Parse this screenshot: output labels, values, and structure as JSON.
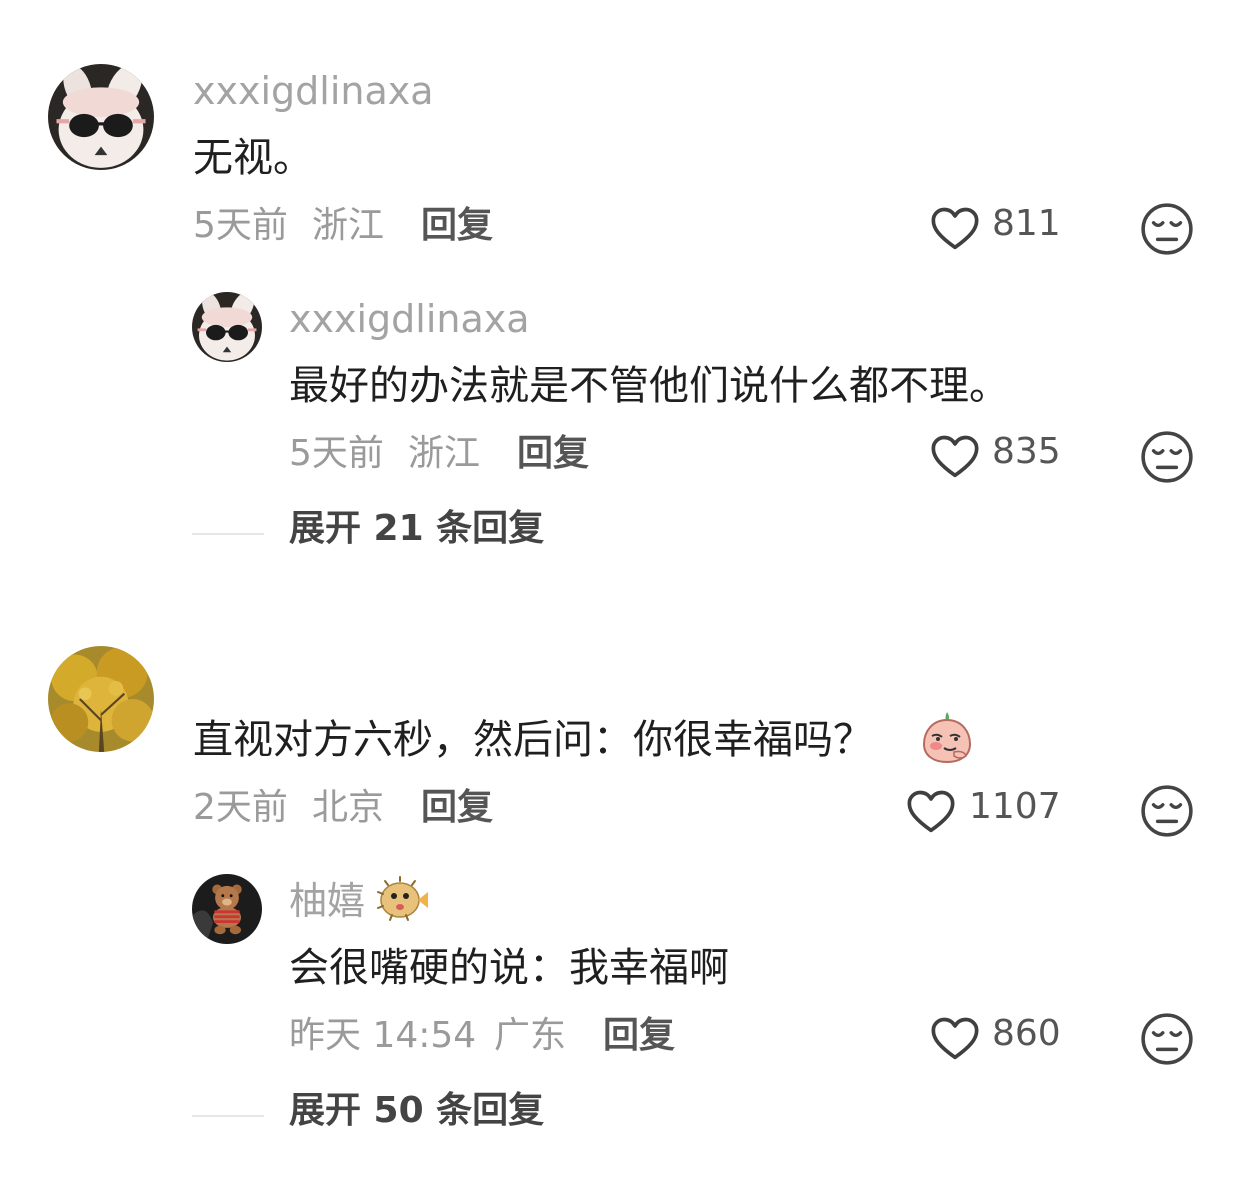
{
  "comments": [
    {
      "username": "xxxigdlinaxa",
      "text": "无视。",
      "time": "5天前",
      "location": "浙江",
      "reply_label": "回复",
      "likes": "811",
      "sub": {
        "username": "xxxigdlinaxa",
        "text": "最好的办法就是不管他们说什么都不理。",
        "time": "5天前",
        "location": "浙江",
        "reply_label": "回复",
        "likes": "835"
      },
      "expand_label": "展开 21 条回复"
    },
    {
      "username": "",
      "text": "直视对方六秒，然后问：你很幸福吗？",
      "emoji": "smirking-peach-sticker",
      "time": "2天前",
      "location": "北京",
      "reply_label": "回复",
      "likes": "1107",
      "sub": {
        "username": "柚嬉",
        "username_emoji": "pufferfish-emoji",
        "text": "会很嘴硬的说：我幸福啊",
        "time": "昨天 14:54",
        "location": "广东",
        "reply_label": "回复",
        "likes": "860"
      },
      "expand_label": "展开 50 条回复"
    }
  ],
  "icons": {
    "like": "heart-outline-icon",
    "dislike": "unamused-face-icon"
  },
  "colors": {
    "username": "#a3a3a3",
    "text": "#1f1f1f",
    "meta": "#9a9a9a",
    "reply": "#555555"
  }
}
